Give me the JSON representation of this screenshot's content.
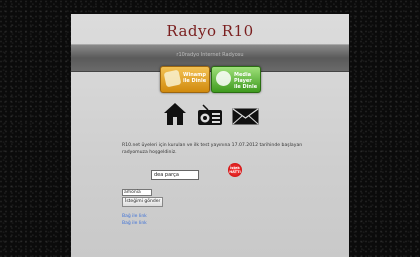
{
  "site": {
    "title": "Radyo R10",
    "bar_text": "r10radyo Internet Radyosu"
  },
  "players": [
    {
      "name": "winamp",
      "label_line1": "Winamp",
      "label_line2": "ile Dinle"
    },
    {
      "name": "media",
      "label_line1": "Media",
      "label_line2": "Player",
      "label_line3": "ile Dinle"
    }
  ],
  "description": "R10.net üyeleri için kurulan ve ilk test yayınına 17.07.2012 tarihinde başlayan radyomuza hoşgeldiniz.",
  "song_request": {
    "song_value": "dea parça",
    "name_value": "amonia",
    "submit_label": "İsteğimi gönder"
  },
  "badge_text": "İstek HATTI",
  "links": [
    "Bağ ile link",
    "Bağ ile link"
  ],
  "colors": {
    "title": "#7a1f1f",
    "badge": "#d40000"
  }
}
